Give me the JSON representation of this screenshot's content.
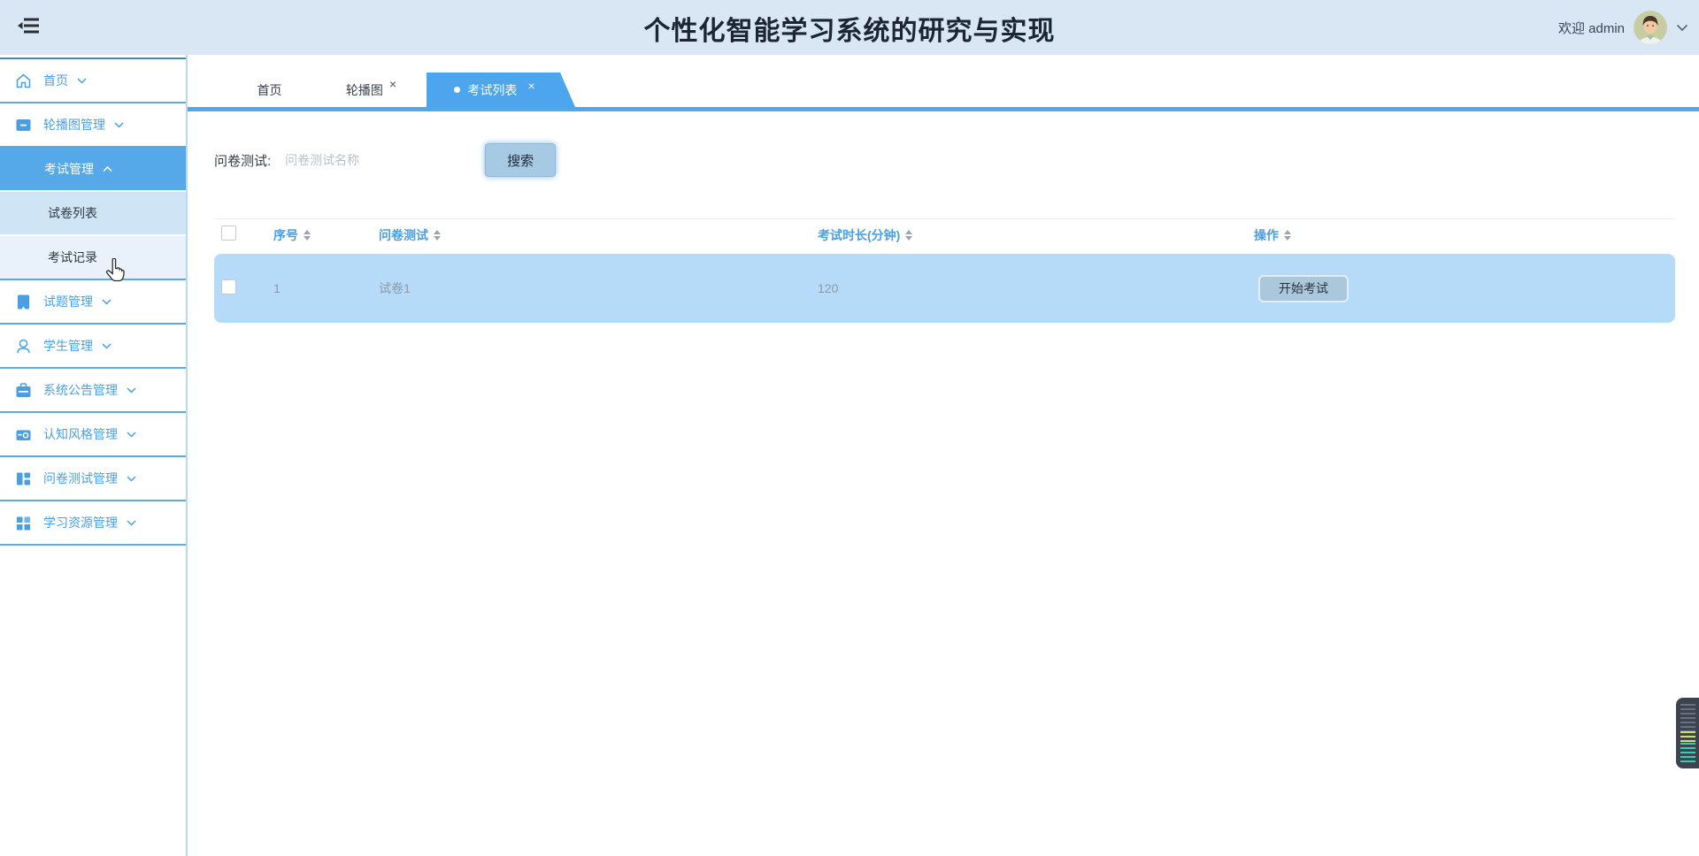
{
  "header": {
    "title": "个性化智能学习系统的研究与实现",
    "welcome": "欢迎 admin"
  },
  "sidebar": {
    "items": [
      {
        "label": "首页"
      },
      {
        "label": "轮播图管理"
      },
      {
        "label": "考试管理"
      },
      {
        "label": "试卷列表"
      },
      {
        "label": "考试记录"
      },
      {
        "label": "试题管理"
      },
      {
        "label": "学生管理"
      },
      {
        "label": "系统公告管理"
      },
      {
        "label": "认知风格管理"
      },
      {
        "label": "问卷测试管理"
      },
      {
        "label": "学习资源管理"
      }
    ]
  },
  "tabs": {
    "items": [
      {
        "label": "首页"
      },
      {
        "label": "轮播图"
      },
      {
        "label": "考试列表"
      }
    ],
    "close_glyph": "×"
  },
  "search": {
    "label": "问卷测试:",
    "placeholder": "问卷测试名称",
    "button_label": "搜索"
  },
  "table": {
    "columns": [
      {
        "label": "序号"
      },
      {
        "label": "问卷测试"
      },
      {
        "label": "考试时长(分钟)"
      },
      {
        "label": "操作"
      }
    ],
    "rows": [
      {
        "seq": "1",
        "quiz": "试卷1",
        "duration": "120",
        "action_label": "开始考试"
      }
    ]
  },
  "colors": {
    "accent_blue": "#4da6ed",
    "sidebar_link_blue": "#4a9fe2",
    "active_menu_bg": "#55a9e9",
    "row_bg": "#b6dbf8",
    "header_bg": "#d9e6f4"
  }
}
